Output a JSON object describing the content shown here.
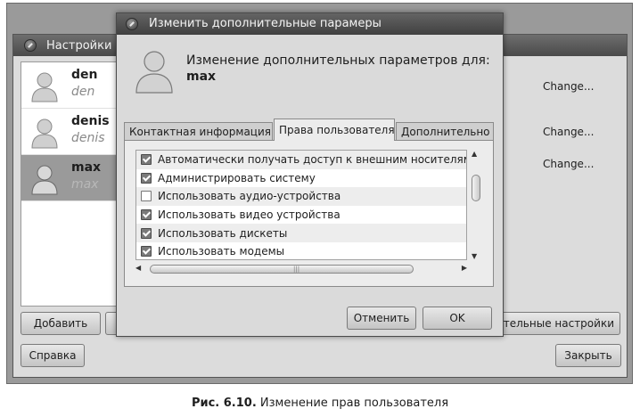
{
  "settings_window": {
    "title": "Настройки",
    "users": [
      {
        "name": "den",
        "login": "den",
        "selected": false
      },
      {
        "name": "denis",
        "login": "denis",
        "selected": false
      },
      {
        "name": "max",
        "login": "max",
        "selected": true
      }
    ],
    "change_label": "Change...",
    "add_button": "Добавить",
    "advanced_settings_partial": "тельные настройки",
    "help_button": "Справка",
    "close_button": "Закрыть"
  },
  "dialog": {
    "title": "Изменить дополнительные парамеры",
    "heading_line1": "Изменение дополнительных параметров для:",
    "heading_user": "max",
    "tabs": [
      {
        "label": "Контактная информация",
        "active": false
      },
      {
        "label": "Права пользователя",
        "active": true
      },
      {
        "label": "Дополнительно",
        "active": false
      }
    ],
    "permissions": [
      {
        "label": "Автоматически получать доступ к внешним носителям",
        "checked": true
      },
      {
        "label": "Администрировать систему",
        "checked": true
      },
      {
        "label": "Использовать аудио-устройства",
        "checked": false
      },
      {
        "label": "Использовать видео устройства",
        "checked": true
      },
      {
        "label": "Использовать дискеты",
        "checked": true
      },
      {
        "label": "Использовать модемы",
        "checked": true
      }
    ],
    "cancel_button": "Отменить",
    "ok_button": "OK"
  },
  "caption": {
    "label": "Рис. 6.10.",
    "text": "Изменение прав пользователя"
  },
  "colors": {
    "titlebar": "#4a4a4a",
    "selected_row": "#9a9a9a",
    "window_bg": "#dcdcdc"
  }
}
